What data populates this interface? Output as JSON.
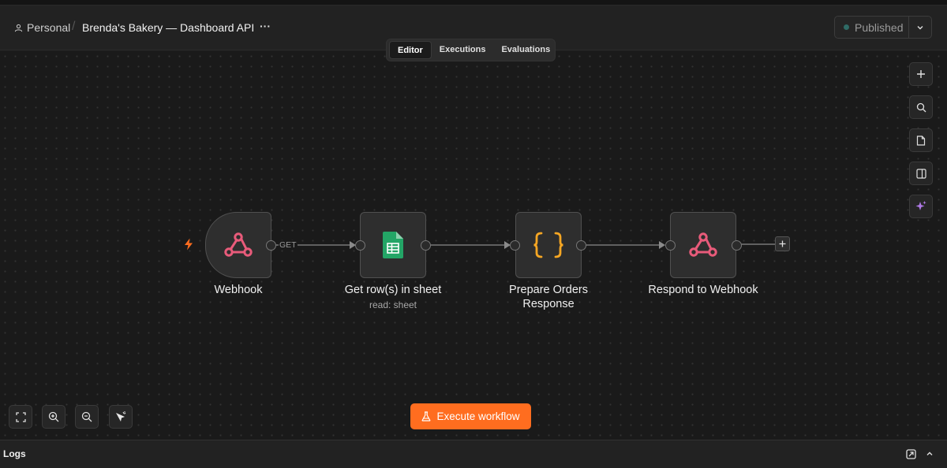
{
  "header": {
    "workspace": "Personal",
    "separator": "/",
    "workflow_title": "Brenda's Bakery — Dashboard API",
    "more": "···",
    "publish_label": "Published"
  },
  "tabs": [
    {
      "label": "Editor",
      "active": true
    },
    {
      "label": "Executions",
      "active": false
    },
    {
      "label": "Evaluations",
      "active": false
    }
  ],
  "side_toolbar": [
    "plus-icon",
    "search-icon",
    "sticky-note-icon",
    "panel-icon",
    "ai-sparkle-icon"
  ],
  "nodes": [
    {
      "label": "Webhook",
      "icon": "webhook-icon",
      "subtitle": ""
    },
    {
      "label": "Get row(s) in sheet",
      "icon": "google-sheets-icon",
      "subtitle": "read: sheet"
    },
    {
      "label": "Prepare Orders Response",
      "icon": "code-braces-icon",
      "subtitle": ""
    },
    {
      "label": "Respond to Webhook",
      "icon": "webhook-icon",
      "subtitle": ""
    }
  ],
  "edge_label": "GET",
  "execute_label": "Execute workflow",
  "logs_label": "Logs",
  "colors": {
    "accent": "#ff6d1f",
    "webhook": "#e85b7a",
    "sheets": "#23a566",
    "braces": "#f5a623",
    "ai": "#b07ae8"
  }
}
